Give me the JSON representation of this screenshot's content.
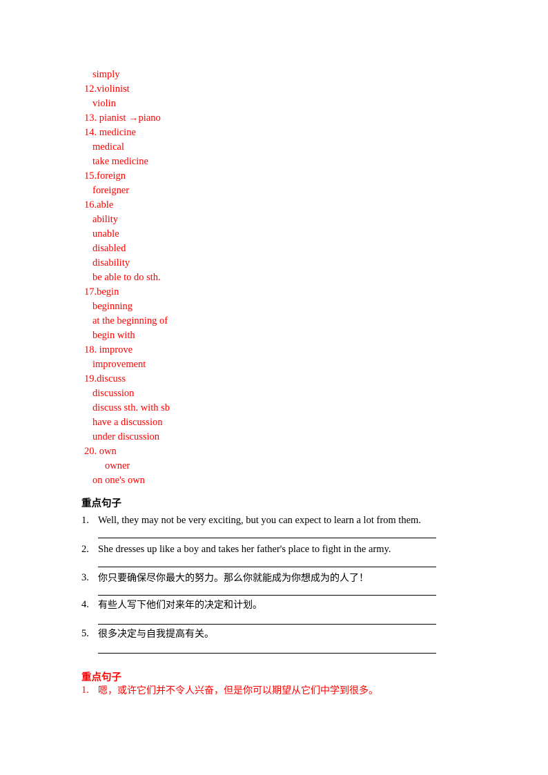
{
  "document": {
    "vocabulary": {
      "lines": [
        {
          "text": "simply",
          "indent": 1
        },
        {
          "text": "12.violinist",
          "indent": 0
        },
        {
          "text": "violin",
          "indent": 1
        },
        {
          "text": "13. pianist →piano",
          "indent": 0
        },
        {
          "text": "14. medicine",
          "indent": 0
        },
        {
          "text": "medical",
          "indent": 1
        },
        {
          "text": "take medicine",
          "indent": 1
        },
        {
          "text": "15.foreign",
          "indent": 0
        },
        {
          "text": "foreigner",
          "indent": 1
        },
        {
          "text": "16.able",
          "indent": 0
        },
        {
          "text": "ability",
          "indent": 1
        },
        {
          "text": "unable",
          "indent": 1
        },
        {
          "text": "disabled",
          "indent": 1
        },
        {
          "text": "disability",
          "indent": 1
        },
        {
          "text": "be able to do sth.",
          "indent": 1
        },
        {
          "text": "17.begin",
          "indent": 0
        },
        {
          "text": "beginning",
          "indent": 1
        },
        {
          "text": "at the beginning of",
          "indent": 1
        },
        {
          "text": "begin with",
          "indent": 1
        },
        {
          "text": "18. improve",
          "indent": 0
        },
        {
          "text": "improvement",
          "indent": 1
        },
        {
          "text": "19.discuss",
          "indent": 0
        },
        {
          "text": "discussion",
          "indent": 1
        },
        {
          "text": "discuss sth. with sb",
          "indent": 1
        },
        {
          "text": "have a discussion",
          "indent": 1
        },
        {
          "text": "under discussion",
          "indent": 1
        },
        {
          "text": "20. own",
          "indent": 0
        },
        {
          "text": "owner",
          "indent": 2
        },
        {
          "text": "on one's own",
          "indent": 1
        }
      ]
    },
    "key_sentences_en": {
      "heading": "重点句子",
      "items": [
        {
          "number": "1.",
          "text": "Well, they may not be very exciting, but you can expect to learn a lot from them.",
          "script": "latin"
        },
        {
          "number": "2.",
          "text": "She dresses up like a boy and takes her father's place to fight in the army.",
          "script": "latin"
        },
        {
          "number": "3.",
          "text": "你只要确保尽你最大的努力。那么你就能成为你想成为的人了！",
          "script": "cjk"
        },
        {
          "number": "4.",
          "text": "有些人写下他们对来年的决定和计划。",
          "script": "cjk"
        },
        {
          "number": "5.",
          "text": "很多决定与自我提高有关。",
          "script": "cjk"
        }
      ]
    },
    "key_sentences_cn": {
      "heading": "重点句子",
      "items": [
        {
          "number": "1.",
          "text": "嗯，或许它们并不令人兴奋，但是你可以期望从它们中学到很多。",
          "script": "cjk"
        }
      ]
    },
    "colors": {
      "vocab_red": "#ff0000",
      "body_black": "#000000",
      "page_background": "#ffffff"
    }
  }
}
